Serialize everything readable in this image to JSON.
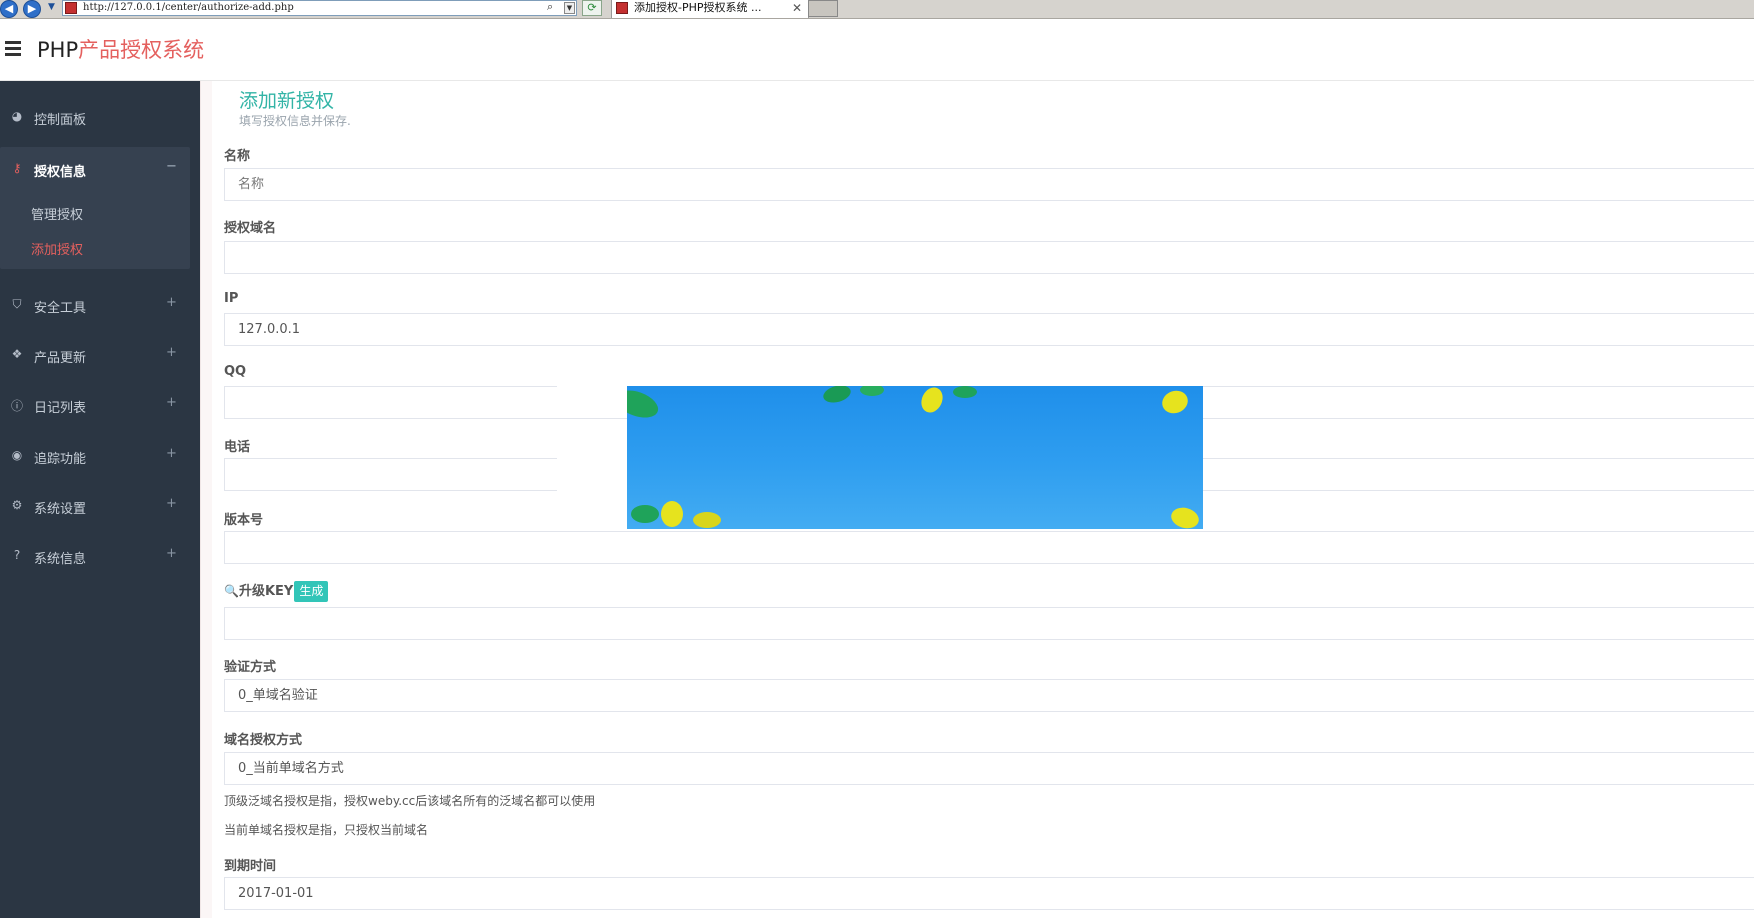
{
  "browser": {
    "url": "http://127.0.0.1/center/authorize-add.php",
    "tab_title": "添加授权-PHP授权系统 ...",
    "tab_close": "✕"
  },
  "header": {
    "brand_php": "PHP",
    "brand_rest": "产品授权系统"
  },
  "sidebar": {
    "items": [
      {
        "label": "控制面板",
        "icon": "dashboard-icon",
        "sign": ""
      },
      {
        "label": "授权信息",
        "icon": "key-icon",
        "sign": "−"
      },
      {
        "label": "安全工具",
        "icon": "shield-icon",
        "sign": "+"
      },
      {
        "label": "产品更新",
        "icon": "tags-icon",
        "sign": "+"
      },
      {
        "label": "日记列表",
        "icon": "info-icon",
        "sign": "+"
      },
      {
        "label": "追踪功能",
        "icon": "target-icon",
        "sign": "+"
      },
      {
        "label": "系统设置",
        "icon": "gears-icon",
        "sign": "+"
      },
      {
        "label": "系统信息",
        "icon": "question-icon",
        "sign": "+"
      }
    ],
    "sub_items": [
      {
        "label": "管理授权",
        "active": false
      },
      {
        "label": "添加授权",
        "active": true
      }
    ]
  },
  "page": {
    "title": "添加新授权",
    "subtitle": "填写授权信息并保存."
  },
  "form": {
    "name_label": "名称",
    "name_placeholder": "名称",
    "domain_label": "授权域名",
    "domain_value": "",
    "ip_label": "IP",
    "ip_value": "127.0.0.1",
    "qq_label": "QQ",
    "qq_value": "",
    "phone_label": "电话",
    "phone_value": "",
    "version_label": "版本号",
    "version_value": "",
    "key_icon": "🔍",
    "key_label": "升级KEY",
    "generate_button": "生成",
    "key_value": "",
    "verify_label": "验证方式",
    "verify_value": "0_单域名验证",
    "domain_mode_label": "域名授权方式",
    "domain_mode_value": "0_当前单域名方式",
    "help_1": "顶级泛域名授权是指，授权weby.cc后该域名所有的泛域名都可以使用",
    "help_2": "当前单域名授权是指，只授权当前域名",
    "expire_label": "到期时间",
    "expire_value": "2017-01-01"
  },
  "colors": {
    "sidebar_bg": "#2b3643",
    "accent_red": "#e4605e",
    "accent_teal": "#32b4a6"
  }
}
